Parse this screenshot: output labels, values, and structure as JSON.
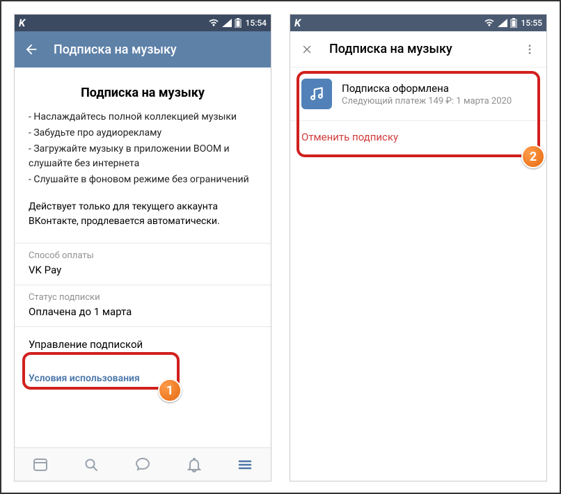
{
  "left": {
    "status": {
      "time": "15:54"
    },
    "toolbar": {
      "title": "Подписка на музыку"
    },
    "heading": "Подписка на музыку",
    "bullets": [
      "- Наслаждайтесь полной коллекцией музыки",
      "- Забудьте про аудиорекламу",
      "- Загружайте музыку в приложении BOOM и слушайте без интернета",
      "- Слушайте в фоновом режиме без ограничений"
    ],
    "note": "Действует только для текущего аккаунта ВКонтакте, продлевается автоматически.",
    "payment": {
      "label": "Способ оплаты",
      "value": "VK Pay"
    },
    "status_sec": {
      "label": "Статус подписки",
      "value": "Оплачена до 1 марта"
    },
    "manage": "Управление подпиской",
    "terms": "Условия использования",
    "badge": "1"
  },
  "right": {
    "status": {
      "time": "15:55"
    },
    "toolbar": {
      "title": "Подписка на музыку"
    },
    "sub": {
      "title": "Подписка оформлена",
      "detail": "Следующий платеж 149 ₽: 1 марта 2020"
    },
    "cancel": "Отменить подписку",
    "badge": "2"
  }
}
